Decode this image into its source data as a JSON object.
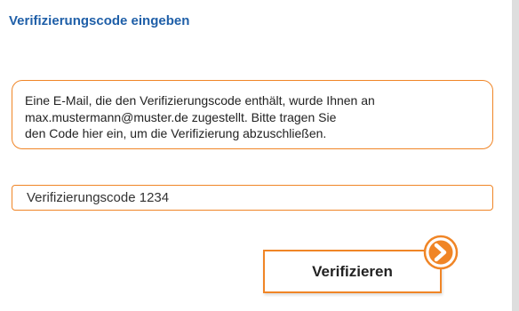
{
  "header": {
    "title": "Verifizierungscode eingeben"
  },
  "info": {
    "lines": [
      "Eine E-Mail, die den Verifizierungscode enthält, wurde Ihnen an",
      "max.mustermann@muster.de  zugestellt. Bitte tragen Sie",
      "den Code hier ein, um die Verifizierung abzuschließen."
    ]
  },
  "code_field": {
    "value": "Verifizierungscode 1234"
  },
  "verify_button": {
    "label": "Verifizieren",
    "icon": "chevron-right-icon"
  },
  "colors": {
    "accent": "#f08526",
    "title": "#1f5fa8",
    "background": "#dedede",
    "panel": "#ffffff"
  }
}
